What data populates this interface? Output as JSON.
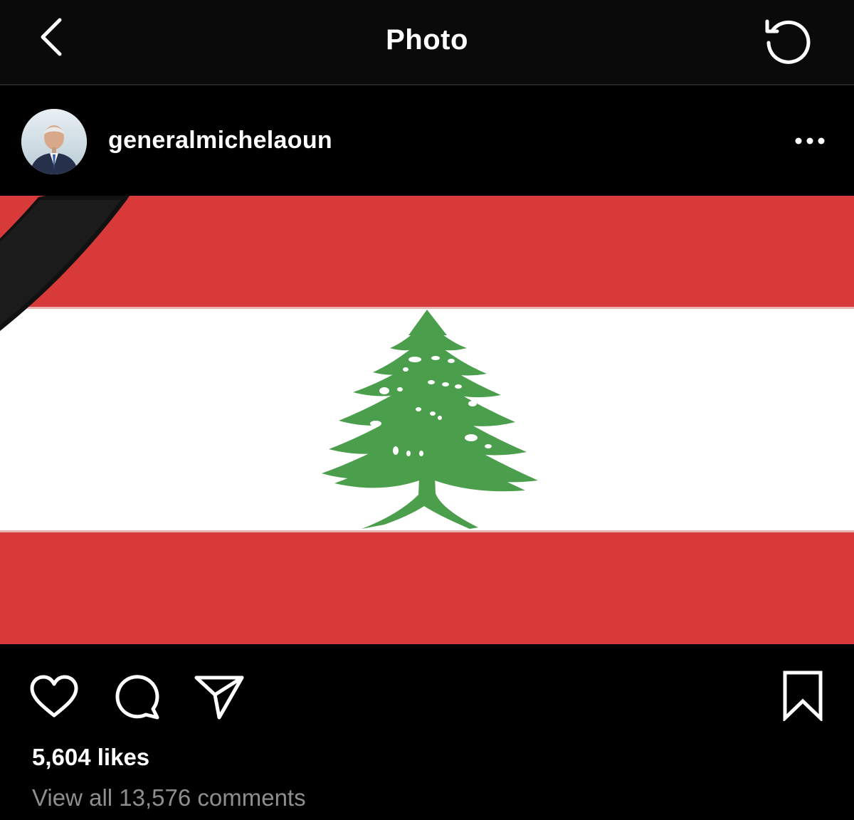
{
  "nav": {
    "title": "Photo",
    "back_icon": "chevron-left-icon",
    "refresh_icon": "refresh-icon"
  },
  "post": {
    "username": "generalmichelaoun",
    "more_icon": "more-horizontal-icon",
    "image": {
      "subject": "Lebanese flag with black mourning ribbon",
      "colors": {
        "red": "#d83a3a",
        "white": "#ffffff",
        "cedar_green": "#4a9e4c",
        "ribbon": "#111111"
      }
    },
    "actions": {
      "like_icon": "heart-icon",
      "comment_icon": "comment-icon",
      "share_icon": "send-icon",
      "save_icon": "bookmark-icon"
    },
    "likes": "5,604 likes",
    "view_comments": "View all 13,576 comments"
  },
  "theme": {
    "background": "#000000",
    "nav_background": "#0a0a0a",
    "text": "#ffffff",
    "muted_text": "#8e8e8e"
  }
}
